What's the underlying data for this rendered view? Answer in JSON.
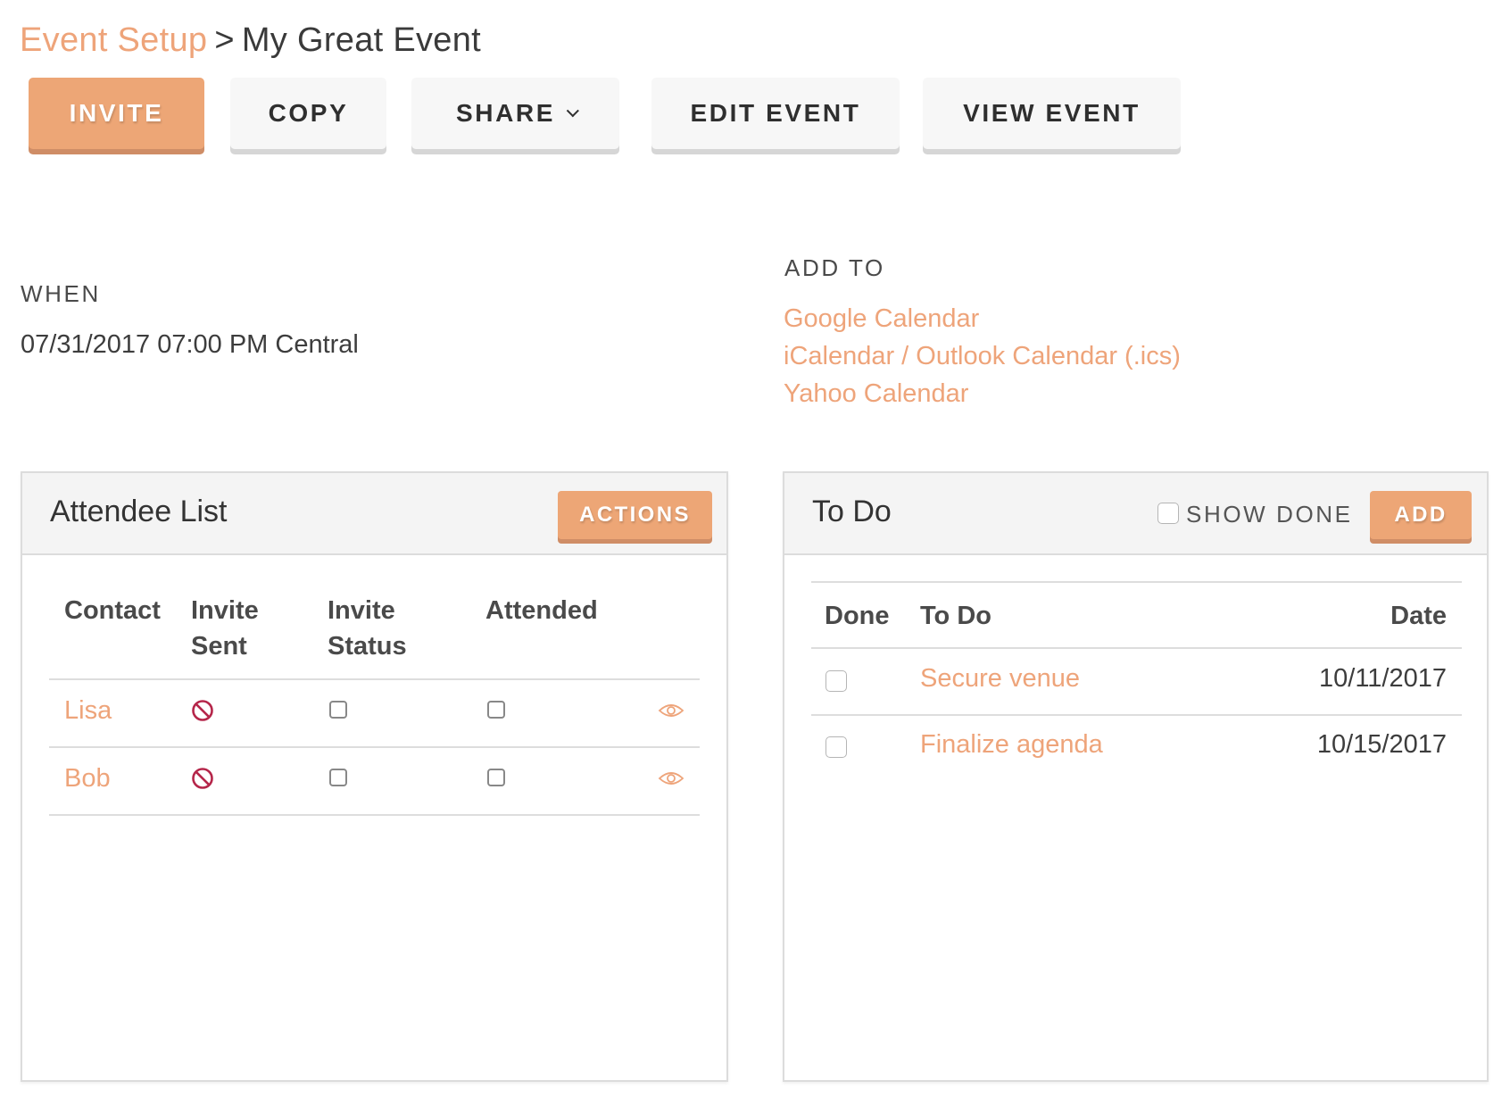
{
  "breadcrumb": {
    "parent": "Event Setup",
    "separator": ">",
    "current": "My Great Event"
  },
  "toolbar": {
    "invite": "INVITE",
    "copy": "COPY",
    "share": "SHARE",
    "edit_event": "EDIT EVENT",
    "view_event": "VIEW EVENT"
  },
  "when": {
    "label": "WHEN",
    "value": "07/31/2017 07:00 PM Central"
  },
  "add_to": {
    "label": "ADD TO",
    "links": [
      "Google Calendar",
      "iCalendar / Outlook Calendar (.ics)",
      "Yahoo Calendar"
    ]
  },
  "attendees": {
    "title": "Attendee List",
    "actions_label": "ACTIONS",
    "columns": [
      "Contact",
      "Invite\nSent",
      "Invite\nStatus",
      "Attended"
    ],
    "columns_lines": [
      [
        "Contact"
      ],
      [
        "Invite",
        "Sent"
      ],
      [
        "Invite",
        "Status"
      ],
      [
        "Attended"
      ]
    ],
    "rows": [
      {
        "contact": "Lisa",
        "invite_sent": "not-sent",
        "invite_status": false,
        "attended": false
      },
      {
        "contact": "Bob",
        "invite_sent": "not-sent",
        "invite_status": false,
        "attended": false
      }
    ]
  },
  "todo": {
    "title": "To Do",
    "show_done_label": "SHOW DONE",
    "show_done_checked": false,
    "add_label": "ADD",
    "columns": [
      "Done",
      "To Do",
      "Date"
    ],
    "rows": [
      {
        "done": false,
        "task": "Secure venue",
        "date": "10/11/2017"
      },
      {
        "done": false,
        "task": "Finalize agenda",
        "date": "10/15/2017"
      }
    ]
  },
  "colors": {
    "accent": "#eda676",
    "link": "#eea47a",
    "not_sent_icon": "#b5264a"
  },
  "icons": {
    "invite_sent": "ban-icon",
    "row_view": "eye-icon",
    "share_dropdown": "chevron-down-icon"
  }
}
